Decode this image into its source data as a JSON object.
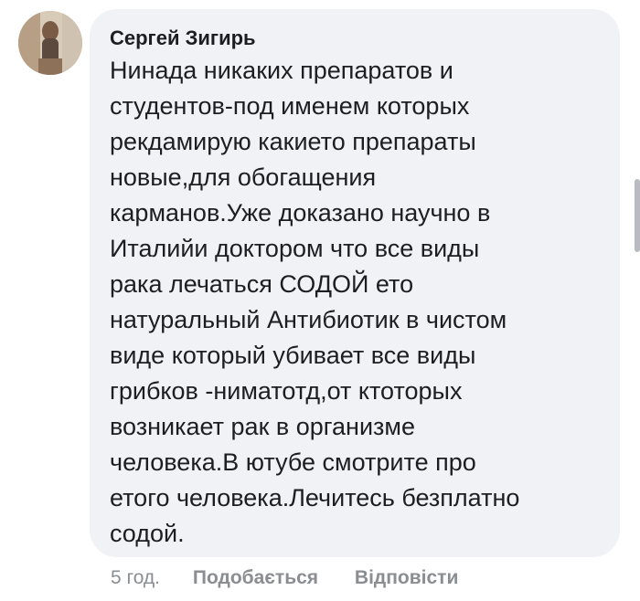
{
  "comment": {
    "author": "Сергей Зигирь",
    "lines": [
      "Нинада никаких препаратов и",
      "студентов-под именем которых",
      "рекдамирую какието препараты",
      "новые,для обогащения",
      "карманов.Уже доказано научно в",
      "Италийи доктором что все виды",
      "рака лечаться СОДОЙ ето",
      "натуральный Антибиотик в чистом",
      "виде который убивает все виды",
      "грибков -ниматотд,от ктоторых",
      "возникает рак в организме",
      "человека.В ютубе смотрите про",
      "етого человека.Лечитесь безплатно",
      "содой."
    ],
    "time": "5 год.",
    "like_label": "Подобається",
    "reply_label": "Відповісти"
  },
  "colors": {
    "bubble": "#f0f2f5",
    "text": "#1c1e21",
    "meta": "#8a8d91"
  }
}
